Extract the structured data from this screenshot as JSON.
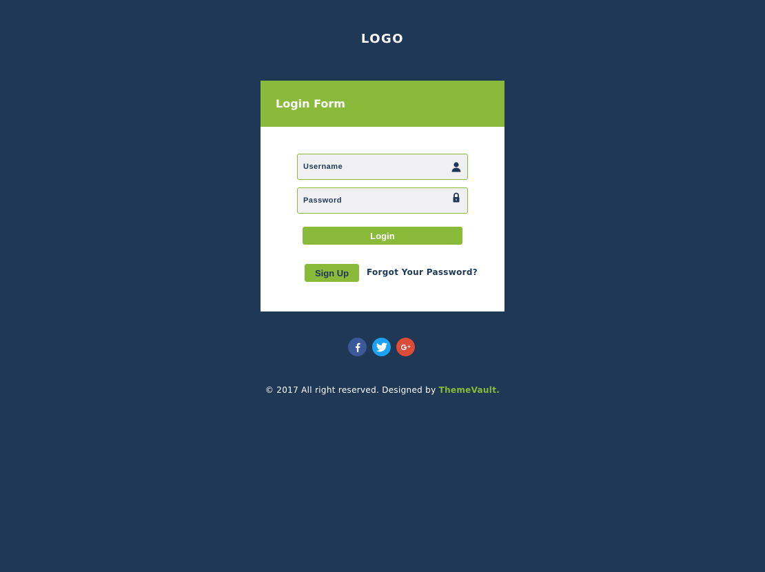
{
  "logo": {
    "text": "LOGO"
  },
  "form": {
    "title": "Login Form",
    "username": {
      "placeholder": "Username",
      "value": "",
      "icon": "user-icon"
    },
    "password": {
      "placeholder": "Password",
      "value": "",
      "icon": "lock-icon"
    },
    "login_label": "Login",
    "signup_label": "Sign Up",
    "forgot_label": "Forgot Your Password?"
  },
  "social": [
    {
      "name": "facebook",
      "icon": "facebook-icon",
      "color": "#3b5998"
    },
    {
      "name": "twitter",
      "icon": "twitter-icon",
      "color": "#1da1f2"
    },
    {
      "name": "google-plus",
      "icon": "google-plus-icon",
      "color": "#dd4b39"
    }
  ],
  "footer": {
    "text": "© 2017 All right reserved. Designed by ",
    "brand": "ThemeVault."
  },
  "colors": {
    "background": "#1e3855",
    "accent": "#8aba3a",
    "field_bg": "#f0eff2"
  }
}
